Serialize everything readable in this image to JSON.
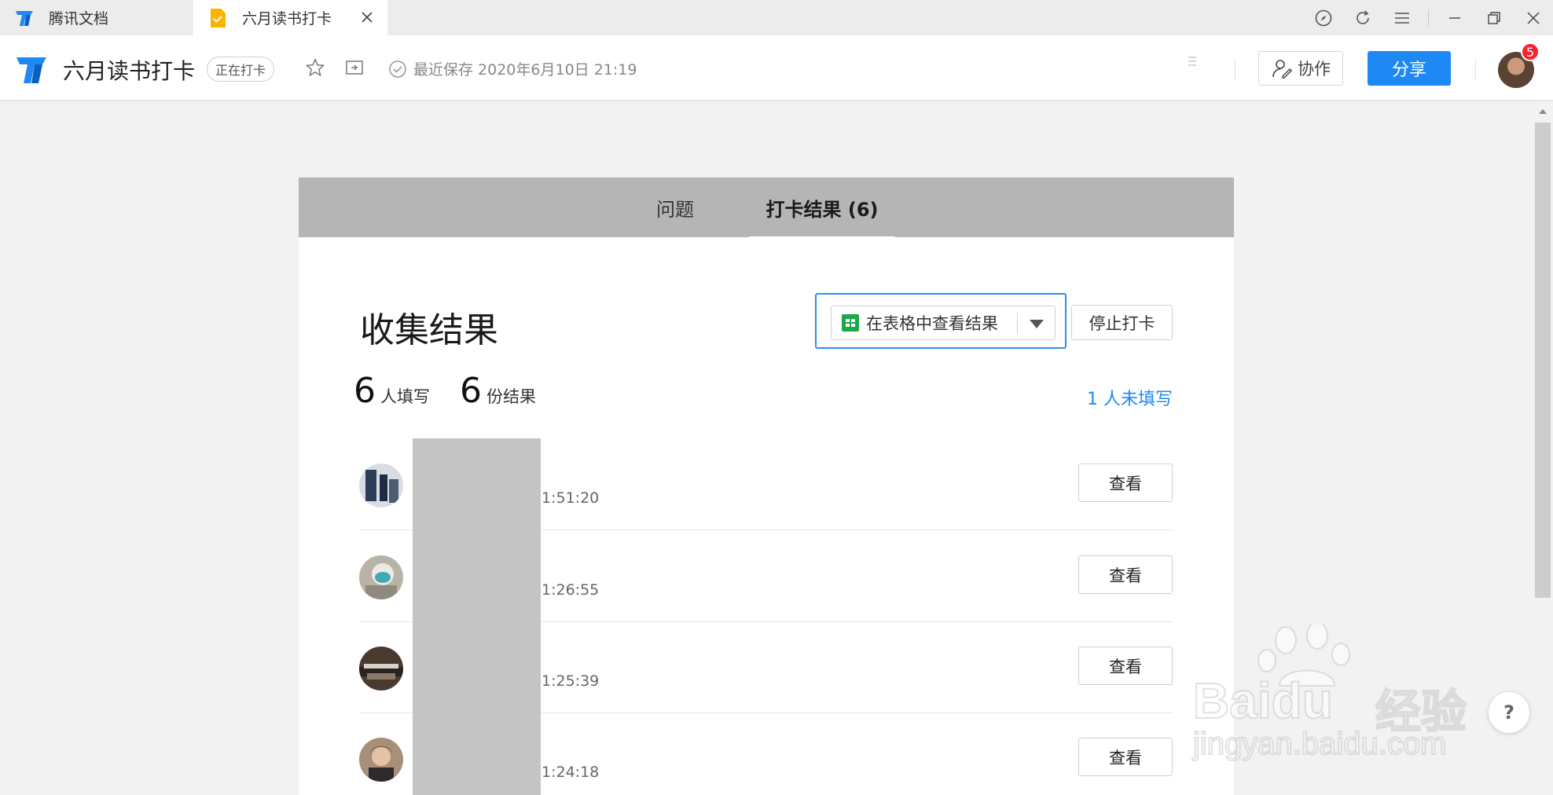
{
  "tabs": [
    {
      "label": "腾讯文档",
      "active": false
    },
    {
      "label": "六月读书打卡",
      "active": true
    }
  ],
  "header": {
    "doc_title": "六月读书打卡",
    "status": "正在打卡",
    "save_info": "最近保存 2020年6月10日 21:19",
    "collab_label": "协作",
    "share_label": "分享",
    "notification_count": "5"
  },
  "card_tabs": [
    {
      "label": "问题",
      "active": false
    },
    {
      "label": "打卡结果 (6)",
      "active": true
    }
  ],
  "results": {
    "title": "收集结果",
    "view_in_sheet_label": "在表格中查看结果",
    "stop_label": "停止打卡",
    "filled_count": "6",
    "filled_label": "人填写",
    "result_count": "6",
    "result_label": "份结果",
    "unfilled_label": "1 人未填写",
    "rows": [
      {
        "time": "1:51:20",
        "view_label": "查看"
      },
      {
        "time": "1:26:55",
        "view_label": "查看"
      },
      {
        "time": "1:25:39",
        "view_label": "查看"
      },
      {
        "time": "1:24:18",
        "view_label": "查看"
      }
    ]
  },
  "help_label": "?",
  "watermark": {
    "brand": "Baidu",
    "brand_cn": "经验",
    "url": "jingyan.baidu.com"
  },
  "colors": {
    "accent": "#1e88f5",
    "badge": "#f5222d",
    "tab_bar_gray": "#b5b5b5"
  }
}
